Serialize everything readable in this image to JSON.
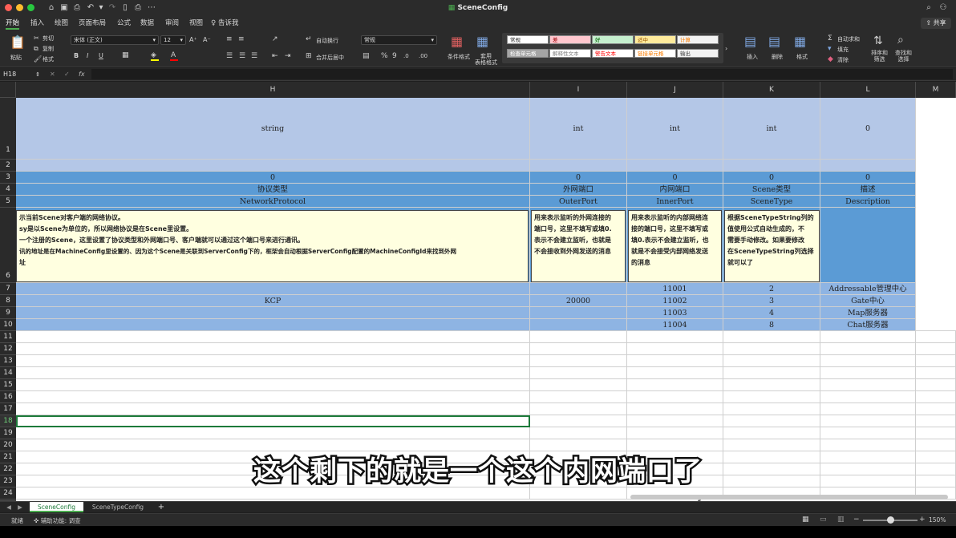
{
  "window": {
    "title": "SceneConfig"
  },
  "ribbon_tabs": [
    "开始",
    "插入",
    "绘图",
    "页面布局",
    "公式",
    "数据",
    "审阅",
    "视图"
  ],
  "tell_me": "告诉我",
  "share": "共享",
  "ribbon": {
    "paste": "粘贴",
    "cut": "剪切",
    "copy": "复制",
    "format_painter": "格式",
    "font_name": "宋体 (正文)",
    "font_size": "12",
    "wrap": "自动换行",
    "merge": "合并后居中",
    "number_format": "常规",
    "cond_format": "条件格式",
    "table_format": "套用\n表格格式",
    "styles": [
      {
        "label": "常规",
        "bg": "#ffffff",
        "fg": "#222222"
      },
      {
        "label": "差",
        "bg": "#ffc7ce",
        "fg": "#9c0006"
      },
      {
        "label": "好",
        "bg": "#c6efce",
        "fg": "#006100"
      },
      {
        "label": "适中",
        "bg": "#ffeb9c",
        "fg": "#9c5700"
      },
      {
        "label": "计算",
        "bg": "#f2f2f2",
        "fg": "#fa7d00"
      },
      {
        "label": "检查单元格",
        "bg": "#a5a5a5",
        "fg": "#ffffff"
      },
      {
        "label": "解释性文本",
        "bg": "#ffffff",
        "fg": "#7f7f7f"
      },
      {
        "label": "警告文本",
        "bg": "#ffffff",
        "fg": "#ff0000"
      },
      {
        "label": "链接单元格",
        "bg": "#ffffff",
        "fg": "#fa7d00"
      },
      {
        "label": "输出",
        "bg": "#f2f2f2",
        "fg": "#3f3f3f"
      }
    ],
    "insert": "插入",
    "delete": "删除",
    "format": "格式",
    "autosum": "自动求和",
    "fill": "填充",
    "clear": "清除",
    "sort": "排序和\n筛选",
    "find": "查找和\n选择"
  },
  "formula_bar": {
    "cell_ref": "H18",
    "fx": "fx",
    "value": ""
  },
  "columns": [
    {
      "label": "H"
    },
    {
      "label": "I"
    },
    {
      "label": "J"
    },
    {
      "label": "K"
    },
    {
      "label": "L"
    },
    {
      "label": "M"
    }
  ],
  "rows": [
    "1",
    "2",
    "3",
    "4",
    "5",
    "6",
    "7",
    "8",
    "9",
    "10",
    "11",
    "12",
    "13",
    "14",
    "15",
    "16",
    "17",
    "18",
    "19",
    "20",
    "21",
    "22",
    "23",
    "24",
    "25"
  ],
  "cells": {
    "r1": [
      "string",
      "int",
      "int",
      "int",
      "0"
    ],
    "r3": [
      "0",
      "0",
      "0",
      "0",
      "0"
    ],
    "r4": [
      "协议类型",
      "外网端口",
      "内网端口",
      "Scene类型",
      "描述"
    ],
    "r5": [
      "NetworkProtocol",
      "OuterPort",
      "InnerPort",
      "SceneType",
      "Description"
    ],
    "r7": [
      "",
      "",
      "11001",
      "2",
      "Addressable管理中心"
    ],
    "r8": [
      "KCP",
      "20000",
      "11002",
      "3",
      "Gate中心"
    ],
    "r9": [
      "",
      "",
      "11003",
      "4",
      "Map服务器"
    ],
    "r10": [
      "",
      "",
      "11004",
      "8",
      "Chat服务器"
    ]
  },
  "comments": {
    "h": [
      "示当前Scene对客户端的网络协议。",
      "sy是以Scene为单位的，所以网络协议是在Scene里设置。",
      "一个注册的Scene，这里设置了协议类型和外网端口号、客户端就可以通过这个端口号来进行通讯。",
      "讯的地址是在MachineConfig里设置的、因为这个Scene是关联到ServerConfig下的，框架会自动根据ServerConfig配置的MachineConfigId来找到外网",
      "址"
    ],
    "i": [
      "用来表示监听的外网连接的",
      "端口号，这里不填写或填0.",
      "表示不会建立监听，也就是",
      "不会接收到外网发送的消息"
    ],
    "j": [
      "用来表示监听的内部网络连",
      "接的端口号，这里不填写或",
      "填0.表示不会建立监听，也",
      "就是不会接受内部网络发送",
      "的消息"
    ],
    "k": [
      "根据SceneTypeString列的",
      "值使用公式自动生成的，不",
      "需要手动修改。如果要修改",
      "在SceneTypeString列选择",
      "就可以了"
    ]
  },
  "sheets": [
    {
      "label": "SceneConfig",
      "active": true
    },
    {
      "label": "SceneTypeConfig",
      "active": false
    }
  ],
  "status": {
    "ready": "就绪",
    "accessibility": "辅助功能: 调查",
    "zoom": "150%"
  },
  "subtitle": "这个剩下的就是一个这个内网端口了",
  "colors": {
    "header_blue": "#b4c7e7",
    "row_blue": "#8eb4e3",
    "deep_blue": "#5b9bd5",
    "comment_yellow": "#ffffe0",
    "accent_green": "#4caf50"
  }
}
